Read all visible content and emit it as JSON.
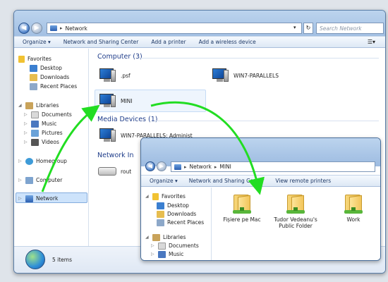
{
  "main_window": {
    "address_root": "Network",
    "search_placeholder": "Search Network",
    "toolbar": {
      "organize": "Organize",
      "sharing_center": "Network and Sharing Center",
      "add_printer": "Add a printer",
      "add_wireless": "Add a wireless device"
    },
    "nav": {
      "favorites": "Favorites",
      "desktop": "Desktop",
      "downloads": "Downloads",
      "recent": "Recent Places",
      "libraries": "Libraries",
      "documents": "Documents",
      "music": "Music",
      "pictures": "Pictures",
      "videos": "Videos",
      "homegroup": "Homegroup",
      "computer": "Computer",
      "network": "Network"
    },
    "groups": {
      "computer": "Computer (3)",
      "media": "Media Devices (1)",
      "infra": "Network In"
    },
    "computers": [
      ".psf",
      "WIN7-PARALLELS",
      "MINI"
    ],
    "media_device": "WIN7-PARALLELS: Administ",
    "infra_device": "rout",
    "status_items": "5 items"
  },
  "sub_window": {
    "address_root": "Network",
    "address_child": "MINI",
    "toolbar": {
      "organize": "Organize",
      "sharing_center": "Network and Sharing Center",
      "remote_printers": "View remote printers"
    },
    "nav": {
      "favorites": "Favorites",
      "desktop": "Desktop",
      "downloads": "Downloads",
      "recent": "Recent Places",
      "libraries": "Libraries",
      "documents": "Documents",
      "music": "Music"
    },
    "folders": [
      "Fișiere pe Mac",
      "Tudor Vedeanu's Public Folder",
      "Work"
    ]
  },
  "colors": {
    "arrow": "#22dd22",
    "group_header": "#1f3d8a",
    "selection": "#cde3fb"
  }
}
